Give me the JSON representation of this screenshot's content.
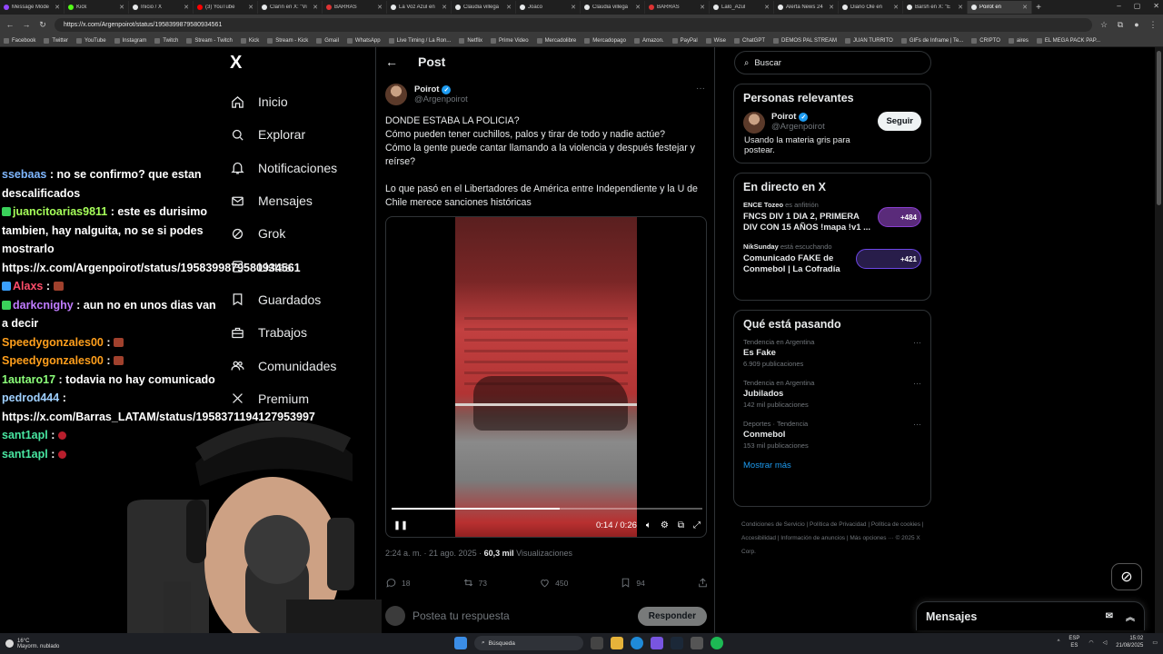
{
  "browser": {
    "tabs": [
      {
        "label": "Message Mode",
        "color": "#9147ff",
        "active": false
      },
      {
        "label": "Kick",
        "color": "#53fc18",
        "active": false
      },
      {
        "label": "Inicio / X",
        "color": "#e7e9ea",
        "active": false
      },
      {
        "label": "(3) YouTube",
        "color": "#ff0000",
        "active": false
      },
      {
        "label": "Clarín en X: \"Vi",
        "color": "#e7e9ea",
        "active": false
      },
      {
        "label": "BARRAS",
        "color": "#d33",
        "active": false
      },
      {
        "label": "La Voz Azul en",
        "color": "#e7e9ea",
        "active": false
      },
      {
        "label": "Claudia villega",
        "color": "#e7e9ea",
        "active": false
      },
      {
        "label": "Joaco",
        "color": "#e7e9ea",
        "active": false
      },
      {
        "label": "Claudia villega",
        "color": "#e7e9ea",
        "active": false
      },
      {
        "label": "BARRAS",
        "color": "#d33",
        "active": false
      },
      {
        "label": "Lalo_Azul",
        "color": "#e7e9ea",
        "active": false
      },
      {
        "label": "Alerta News 24",
        "color": "#e7e9ea",
        "active": false
      },
      {
        "label": "Diario Olé en",
        "color": "#e7e9ea",
        "active": false
      },
      {
        "label": "Barsh en X: \"E",
        "color": "#e7e9ea",
        "active": false
      },
      {
        "label": "Poirot en",
        "color": "#e7e9ea",
        "active": true
      }
    ],
    "new_tab": "+",
    "url": "https://x.com/Argenpoirot/status/1958399879580934561",
    "bookmarks": [
      "Facebook",
      "Twitter",
      "YouTube",
      "Instagram",
      "Twitch",
      "Stream - Twitch",
      "Kick",
      "Stream - Kick",
      "Gmail",
      "WhatsApp",
      "Live Timing / La Ron...",
      "Netflix",
      "Prime Video",
      "Mercadolibre",
      "Mercadopago",
      "Amazon.",
      "PayPal",
      "Wise",
      "ChatGPT",
      "DEMOS PAL STREAM",
      "JUAN TURRITO",
      "GIFs de Inframe | Te...",
      "CRIPTO",
      "aires",
      "EL MEGA PACK PAP..."
    ]
  },
  "chat": [
    {
      "user": "ssebaas",
      "text": ": no se confirmo? que estan descalificados",
      "cls": "u1",
      "badge": "",
      "emote": ""
    },
    {
      "user": "juancitoarias9811",
      "text": ": este es durisimo tambien, hay nalguita, no se si podes mostrarlo https://x.com/Argenpoirot/status/1958399879580934561",
      "cls": "u2",
      "badge": "#3ad15a",
      "emote": ""
    },
    {
      "user": "Alaxs",
      "text": ":",
      "cls": "u3",
      "badge": "#3aa0ff",
      "emote": "box"
    },
    {
      "user": "darkcnighy",
      "text": ": aun no en unos dias van a decir",
      "cls": "u4",
      "badge": "#3ad15a",
      "emote": ""
    },
    {
      "user": "Speedygonzales00",
      "text": ":",
      "cls": "u5",
      "badge": "",
      "emote": "box"
    },
    {
      "user": "Speedygonzales00",
      "text": ":",
      "cls": "u5",
      "badge": "",
      "emote": "box"
    },
    {
      "user": "1autaro17",
      "text": ": todavia no hay comunicado",
      "cls": "u6",
      "badge": "",
      "emote": ""
    },
    {
      "user": "pedrod444",
      "text": ": https://x.com/Barras_LATAM/status/1958371194127953997",
      "cls": "u7",
      "badge": "",
      "emote": ""
    },
    {
      "user": "sant1apl",
      "text": ":",
      "cls": "u8",
      "badge": "",
      "emote": "round"
    },
    {
      "user": "sant1apl",
      "text": ":",
      "cls": "u8",
      "badge": "",
      "emote": "round"
    }
  ],
  "nav": {
    "logo": "X",
    "items": [
      {
        "label": "Inicio",
        "icon": "home-icon"
      },
      {
        "label": "Explorar",
        "icon": "search-icon"
      },
      {
        "label": "Notificaciones",
        "icon": "bell-icon"
      },
      {
        "label": "Mensajes",
        "icon": "mail-icon"
      },
      {
        "label": "Grok",
        "icon": "grok-icon"
      },
      {
        "label": "Listas",
        "icon": "list-icon"
      },
      {
        "label": "Guardados",
        "icon": "bookmark-icon"
      },
      {
        "label": "Trabajos",
        "icon": "briefcase-icon"
      },
      {
        "label": "Comunidades",
        "icon": "people-icon"
      },
      {
        "label": "Premium",
        "icon": "x-premium-icon"
      }
    ]
  },
  "post": {
    "header": "Post",
    "author_name": "Poirot",
    "author_handle": "@Argenpoirot",
    "text_1": "DONDE ESTABA LA POLICIA?\nCómo pueden tener cuchillos, palos y tirar de todo y nadie actúe?\nCómo la gente puede cantar llamando a la violencia y después festejar y reírse?",
    "text_2": "Lo que pasó en el Libertadores de América entre Independiente y la U de Chile merece sanciones históricas",
    "video_time": "0:14 / 0:26",
    "video_progress": 0.54,
    "timestamp": "2:24 a. m. · 21 ago. 2025 · ",
    "views_count": "60,3 mil",
    "views_label": " Visualizaciones",
    "replies": "18",
    "reposts": "73",
    "likes": "450",
    "bookmarks": "94",
    "reply_placeholder": "Postea tu respuesta",
    "reply_button": "Responder"
  },
  "sidebar": {
    "search_placeholder": "Buscar",
    "relevant_title": "Personas relevantes",
    "relevant": {
      "name": "Poirot",
      "handle": "@Argenpoirot",
      "bio": "Usando la materia gris para postear.",
      "follow": "Seguir"
    },
    "live_title": "En directo en X",
    "live": [
      {
        "host": "ENCE Tozeo",
        "host_suffix": " es anfitrión",
        "title": "FNCS DIV 1 DIA 2, PRIMERA DIV CON 15 AÑOS !mapa !v1 ...",
        "count": "+484"
      },
      {
        "host": "NikSunday",
        "host_suffix": " está escuchando",
        "title": "Comunicado FAKE de Conmebol | La Cofradía",
        "count": "+421"
      }
    ],
    "trending_title": "Qué está pasando",
    "trends": [
      {
        "category": "Tendencia en Argentina",
        "name": "Es Fake",
        "count": "6.909 publicaciones"
      },
      {
        "category": "Tendencia en Argentina",
        "name": "Jubilados",
        "count": "142 mil publicaciones"
      },
      {
        "category": "Deportes · Tendencia",
        "name": "Conmebol",
        "count": "153 mil publicaciones"
      }
    ],
    "show_more": "Mostrar más",
    "footer": "Condiciones de Servicio  |  Política de Privacidad  |  Política de cookies  |  Accesibilidad  |  Información de anuncios  |  Más opciones ···  © 2025 X Corp.",
    "messages_label": "Mensajes"
  },
  "taskbar": {
    "temp": "16°C",
    "weather": "Mayorm. nublado",
    "search": "Búsqueda",
    "lang_1": "ESP",
    "lang_2": "ES",
    "time": "15:02",
    "date": "21/08/2025"
  }
}
